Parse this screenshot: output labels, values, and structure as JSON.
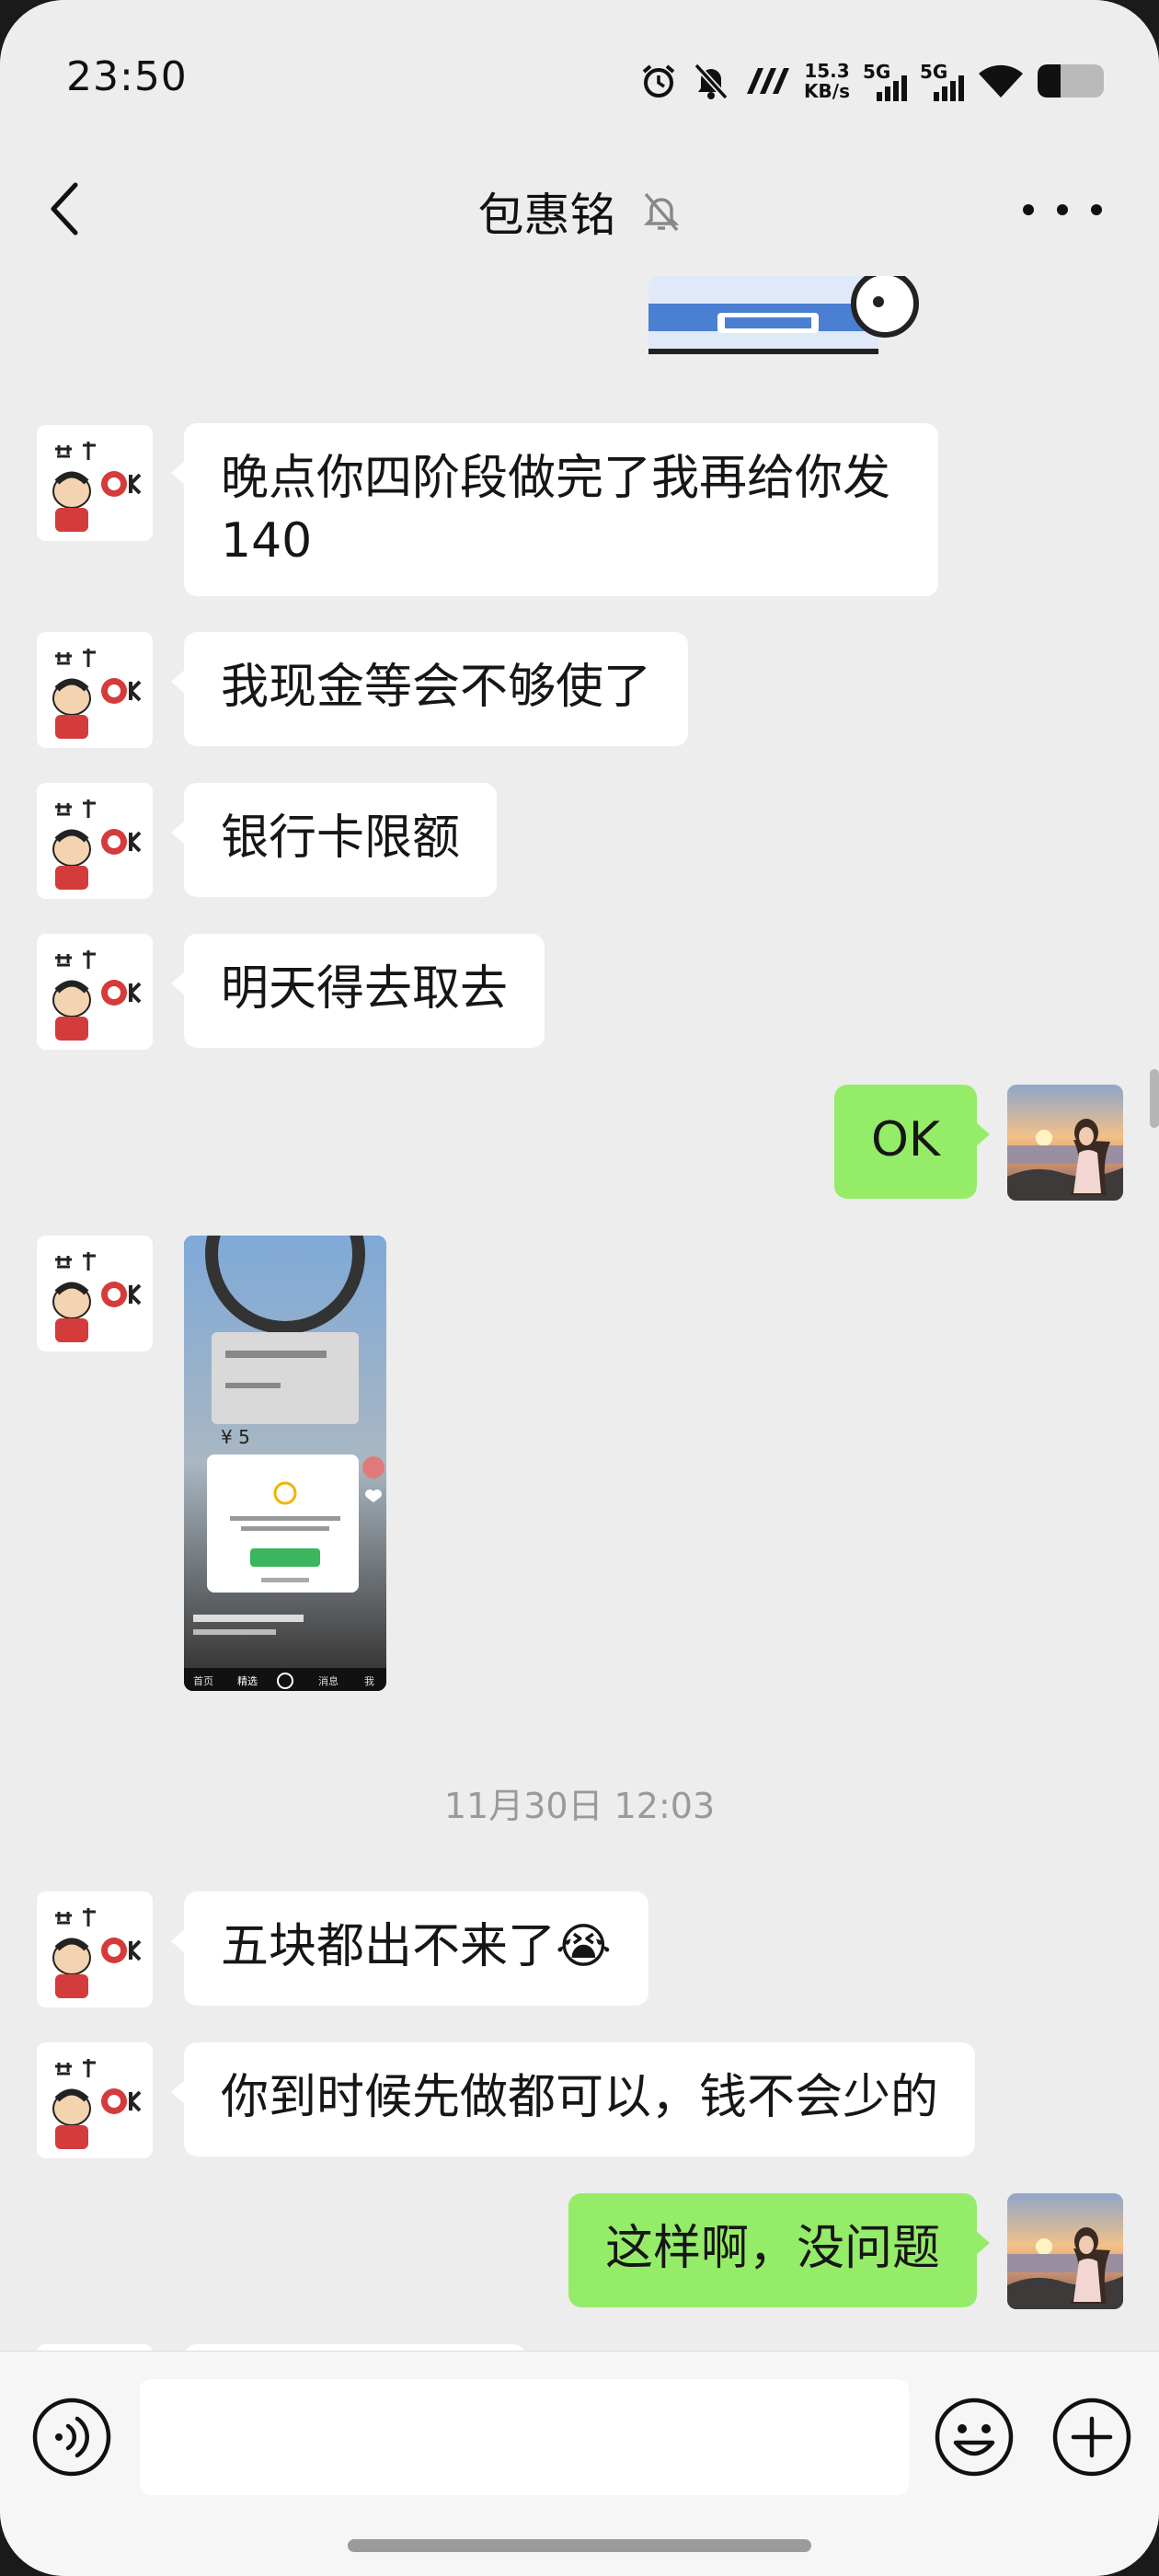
{
  "status_bar": {
    "time": "23:50",
    "net_speed_value": "15.3",
    "net_speed_unit": "KB/s",
    "sim1_label": "5G",
    "sim2_label": "5G",
    "battery_level": 0.35,
    "icons": [
      "alarm-icon",
      "mute-bell-icon",
      "nfc-icon",
      "wifi-icon",
      "battery-icon"
    ]
  },
  "header": {
    "title": "包惠铭",
    "icons": [
      "back-chevron-icon",
      "muted-bell-icon",
      "more-dots-icon"
    ]
  },
  "messages": [
    {
      "side": "in",
      "type": "text",
      "text": "晚点你四阶段做完了我再给你发140"
    },
    {
      "side": "in",
      "type": "text",
      "text": "我现金等会不够使了"
    },
    {
      "side": "in",
      "type": "text",
      "text": "银行卡限额"
    },
    {
      "side": "in",
      "type": "text",
      "text": "明天得去取去"
    },
    {
      "side": "out",
      "type": "text",
      "text": "OK"
    },
    {
      "side": "in",
      "type": "image",
      "description": "screenshot"
    },
    {
      "type": "timestamp",
      "text": "11月30日 12:03"
    },
    {
      "side": "in",
      "type": "text",
      "text": "五块都出不来了",
      "emoji": "😭"
    },
    {
      "side": "in",
      "type": "text",
      "text": "你到时候先做都可以，钱不会少的"
    },
    {
      "side": "out",
      "type": "text",
      "text": "这样啊，没问题"
    }
  ],
  "screenshot_thumb": {
    "amount": "¥ 5",
    "nav": [
      "首页",
      "精选",
      "消息",
      "我"
    ]
  },
  "input_bar": {
    "placeholder": "",
    "icons": [
      "voice-icon",
      "emoji-icon",
      "plus-icon"
    ]
  },
  "colors": {
    "background": "#ededed",
    "incoming_bubble": "#ffffff",
    "outgoing_bubble": "#95ec69",
    "timestamp_text": "#9a9a9a"
  }
}
